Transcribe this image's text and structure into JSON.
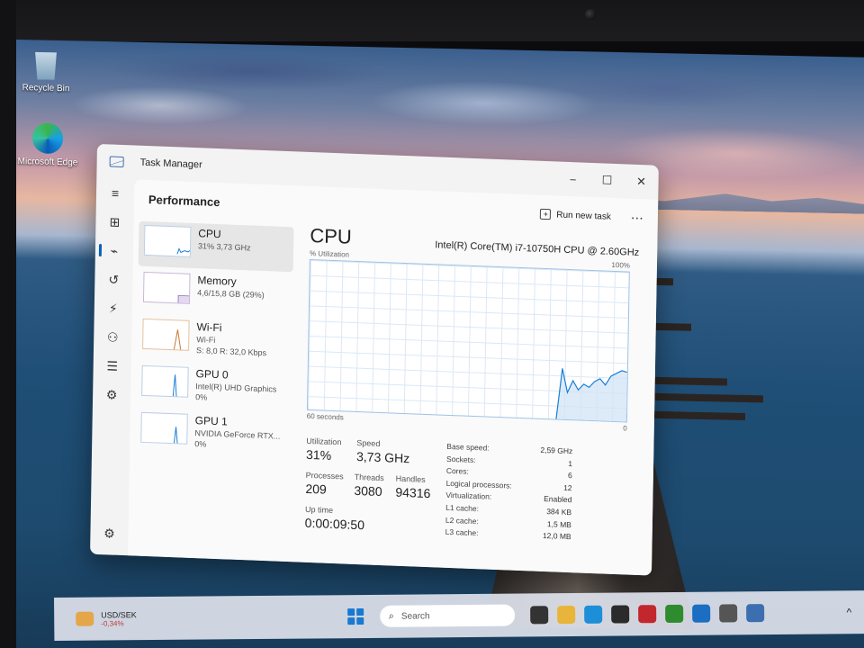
{
  "desktop": {
    "icons": [
      {
        "label": "Recycle Bin",
        "icon": "recycle-bin-icon"
      },
      {
        "label": "Microsoft Edge",
        "icon": "edge-icon"
      }
    ]
  },
  "window": {
    "title": "Task Manager",
    "controls": {
      "minimize": "−",
      "maximize": "☐",
      "close": "✕"
    }
  },
  "rail": {
    "icons": [
      "hamburger-icon",
      "processes-icon",
      "performance-icon",
      "app-history-icon",
      "startup-apps-icon",
      "users-icon",
      "details-icon",
      "services-icon"
    ],
    "glyphs": [
      "≡",
      "⊞",
      "⌁",
      "↺",
      "⚡",
      "⚇",
      "☰",
      "⚙"
    ],
    "settings_glyph": "⚙"
  },
  "header": {
    "page_title": "Performance",
    "run_new_task": "Run new task",
    "more": "⋯"
  },
  "resources": [
    {
      "name": "CPU",
      "sub1": "31% 3,73 GHz",
      "sub2": ""
    },
    {
      "name": "Memory",
      "sub1": "4,6/15,8 GB (29%)",
      "sub2": ""
    },
    {
      "name": "Wi-Fi",
      "sub1": "Wi-Fi",
      "sub2": "S: 8,0 R: 32,0 Kbps"
    },
    {
      "name": "GPU 0",
      "sub1": "Intel(R) UHD Graphics",
      "sub2": "0%"
    },
    {
      "name": "GPU 1",
      "sub1": "NVIDIA GeForce RTX...",
      "sub2": "0%"
    }
  ],
  "cpu": {
    "title": "CPU",
    "model": "Intel(R) Core(TM) i7-10750H CPU @ 2.60GHz",
    "graph_label": "% Utilization",
    "graph_max": "100%",
    "graph_time": "60 seconds",
    "graph_min": "0",
    "series_pct": [
      0,
      0,
      0,
      0,
      0,
      0,
      0,
      0,
      0,
      0,
      0,
      0,
      0,
      0,
      0,
      0,
      0,
      0,
      0,
      0,
      0,
      0,
      0,
      0,
      0,
      0,
      0,
      0,
      0,
      0,
      0,
      0,
      0,
      0,
      0,
      0,
      0,
      0,
      0,
      0,
      0,
      0,
      0,
      0,
      0,
      0,
      0,
      34,
      18,
      26,
      20,
      24,
      22,
      26,
      28,
      24,
      30,
      32,
      34,
      33
    ],
    "utilization_label": "Utilization",
    "utilization_value": "31%",
    "speed_label": "Speed",
    "speed_value": "3,73 GHz",
    "processes_label": "Processes",
    "processes_value": "209",
    "threads_label": "Threads",
    "threads_value": "3080",
    "handles_label": "Handles",
    "handles_value": "94316",
    "uptime_label": "Up time",
    "uptime_value": "0:00:09:50",
    "specs": [
      {
        "k": "Base speed:",
        "v": "2,59 GHz"
      },
      {
        "k": "Sockets:",
        "v": "1"
      },
      {
        "k": "Cores:",
        "v": "6"
      },
      {
        "k": "Logical processors:",
        "v": "12"
      },
      {
        "k": "Virtualization:",
        "v": "Enabled"
      },
      {
        "k": "L1 cache:",
        "v": "384 KB"
      },
      {
        "k": "L2 cache:",
        "v": "1,5 MB"
      },
      {
        "k": "L3 cache:",
        "v": "12,0 MB"
      }
    ]
  },
  "taskbar": {
    "ticker_name": "USD/SEK",
    "ticker_change": "-0,34%",
    "search_placeholder": "Search",
    "search_glyph": "⌕",
    "overflow": "^",
    "apps": [
      "task-view-icon",
      "file-explorer-icon",
      "edge-icon",
      "store-icon",
      "red-app-icon",
      "xbox-icon",
      "outlook-icon",
      "settings-icon",
      "task-manager-icon"
    ],
    "app_colors": [
      "#333333",
      "#e8b43a",
      "#1d8fd8",
      "#2b2b2b",
      "#c1272d",
      "#2e8b2e",
      "#1b6ec2",
      "#555555",
      "#3d6fb0"
    ]
  },
  "colors": {
    "accent": "#0a5fb6",
    "cpu_line": "#1c7fd6",
    "cpu_fill": "#cfe3f6"
  }
}
